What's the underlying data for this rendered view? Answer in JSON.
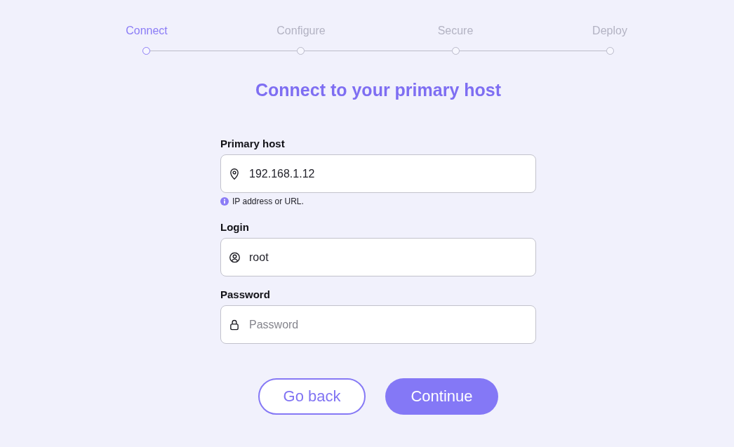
{
  "steps": [
    {
      "label": "Connect",
      "selected": true
    },
    {
      "label": "Configure",
      "selected": false
    },
    {
      "label": "Secure",
      "selected": false
    },
    {
      "label": "Deploy",
      "selected": false
    }
  ],
  "title": "Connect to your primary host",
  "fields": [
    {
      "kind": "host",
      "label": "Primary host",
      "value": "192.168.1.12",
      "helper": "IP address or URL."
    },
    {
      "kind": "login",
      "label": "Login",
      "value": "root"
    },
    {
      "kind": "password",
      "label": "Password",
      "placeholder": "Password"
    }
  ],
  "buttons": [
    {
      "kind": "secondary",
      "label": "Go back"
    },
    {
      "kind": "primary",
      "label": "Continue"
    }
  ]
}
